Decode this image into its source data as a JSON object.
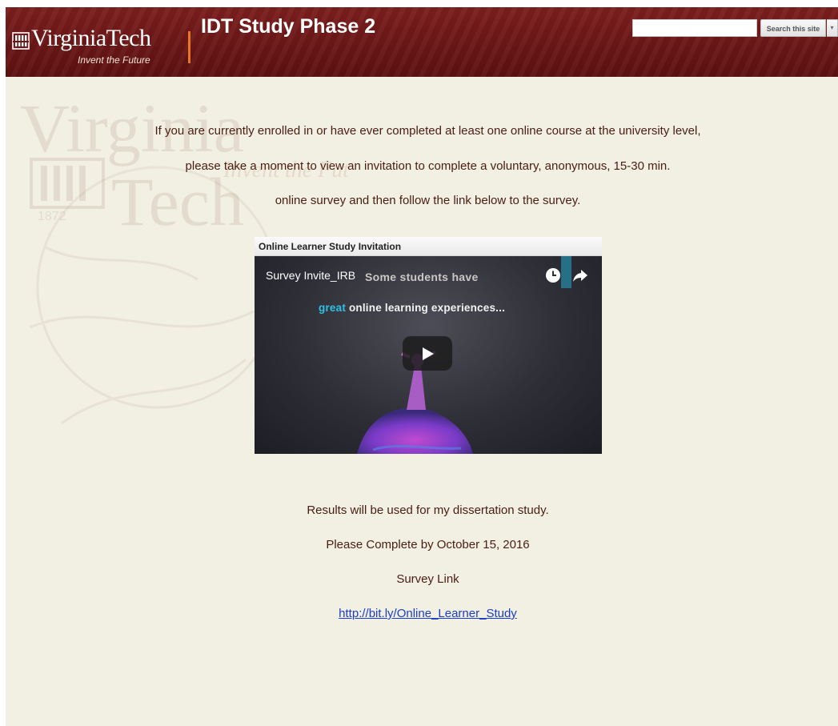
{
  "header": {
    "logo": {
      "wordmark": "VirginiaTech",
      "tagline": "Invent the Future"
    },
    "site_title": "IDT Study Phase 2",
    "search": {
      "placeholder": "",
      "value": "",
      "button_label": "Search this site",
      "dropdown_icon": "chevron-down-icon"
    }
  },
  "watermark": {
    "line1": "Virginia",
    "line2": "Tech",
    "tagline": "Invent the Future",
    "year": "1872"
  },
  "intro": {
    "lines": [
      "If you are currently enrolled in or have ever completed at least one online course at the university level,",
      "please take a moment to view an invitation to complete a voluntary, anonymous, 15-30 min.",
      "online survey and then follow the link below to the survey."
    ]
  },
  "video": {
    "panel_title": "Online Learner Study Invitation",
    "video_title": "Survey Invite_IRB",
    "caption_line1": "Some students have",
    "caption_accent": "great",
    "caption_rest": "online learning experiences...",
    "icons": [
      "clock-icon",
      "share-icon",
      "play-icon"
    ]
  },
  "footer": {
    "results_text": "Results will be used for my dissertation study.",
    "deadline_text": "Please Complete by October 15, 2016",
    "survey_label": "Survey Link",
    "survey_url": "http://bit.ly/Online_Learner_Study"
  },
  "colors": {
    "header_maroon": "#6a1616",
    "accent_orange": "#e87722",
    "page_background": "#f2efe3",
    "body_text": "#4a1d13",
    "link": "#1a3dcc"
  }
}
